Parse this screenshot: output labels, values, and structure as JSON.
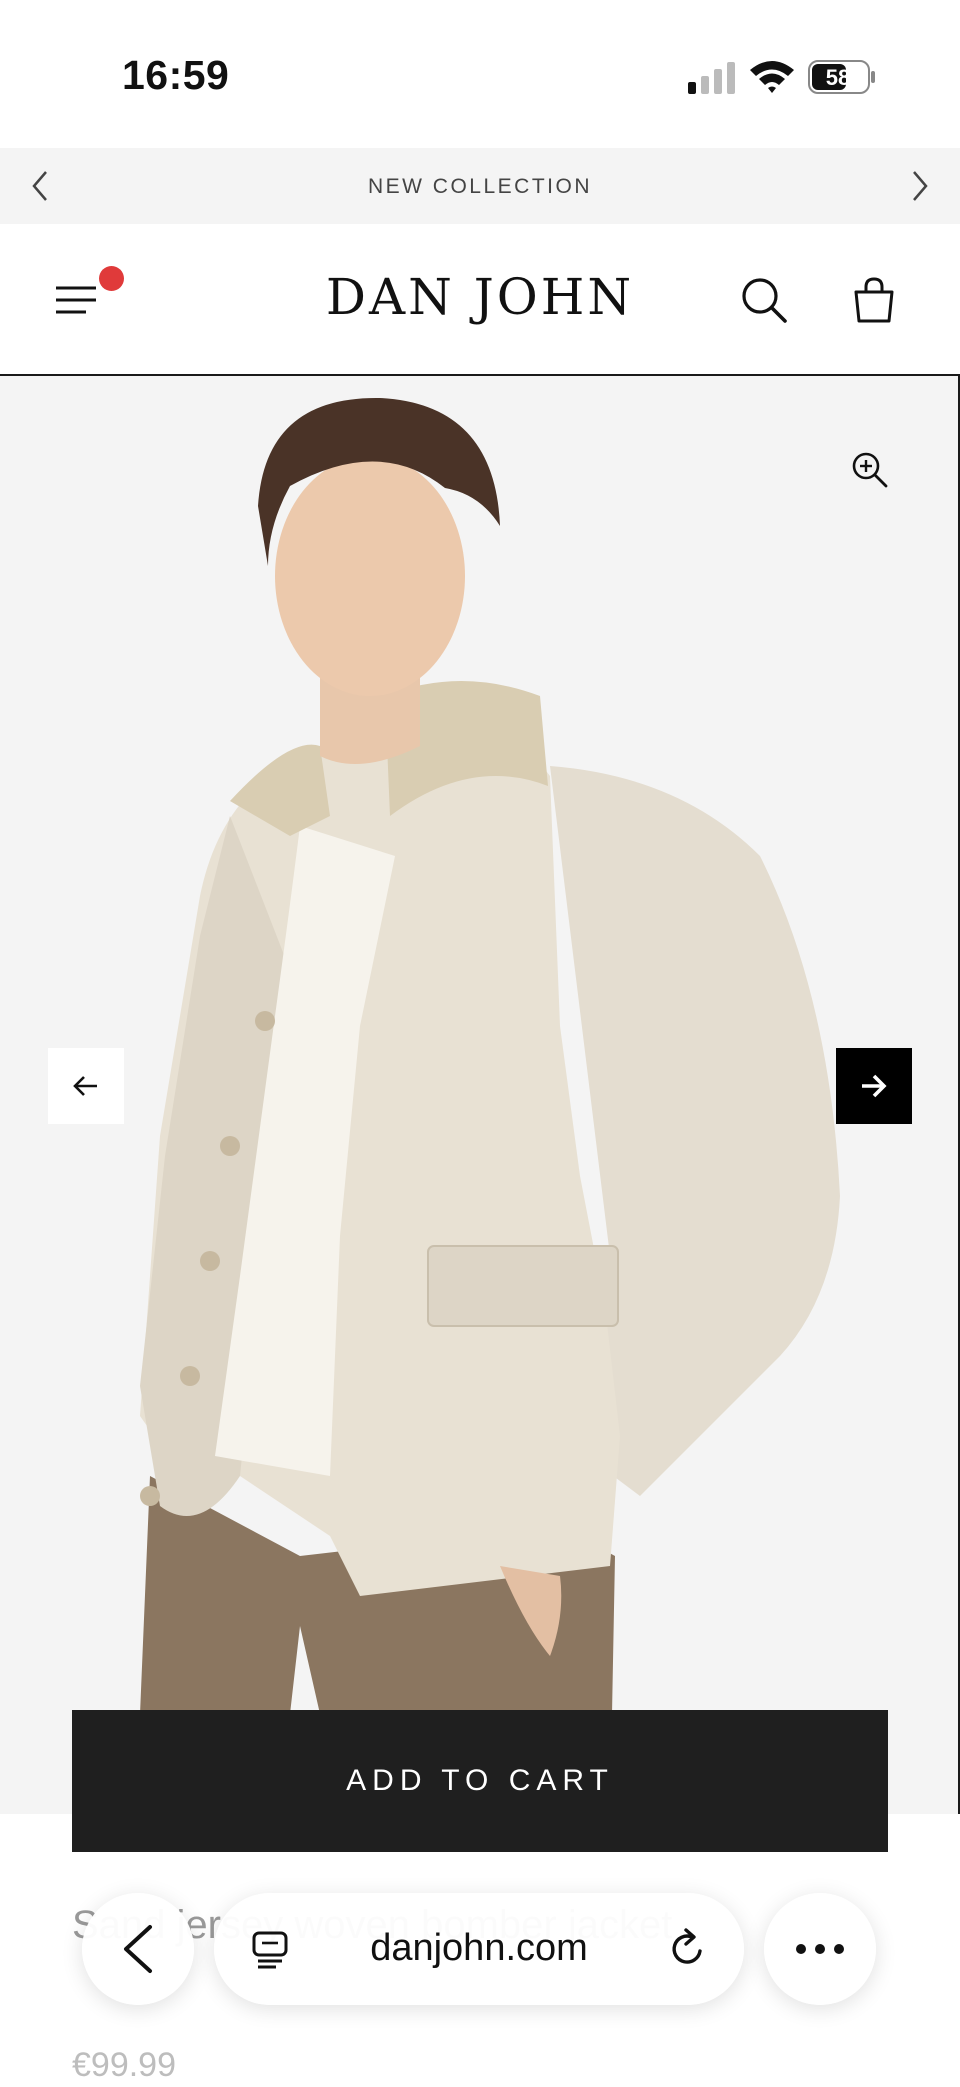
{
  "status_bar": {
    "time": "16:59",
    "battery": "58"
  },
  "announcement": {
    "text": "NEW COLLECTION",
    "prev_icon": "chevron-left-icon",
    "next_icon": "chevron-right-icon"
  },
  "header": {
    "logo": "DAN JOHN",
    "menu_icon": "hamburger-menu-icon",
    "notification_color": "#e03a3a",
    "search_icon": "search-icon",
    "bag_icon": "shopping-bag-icon"
  },
  "gallery": {
    "background": "#f4f4f4",
    "zoom_icon": "zoom-in-icon",
    "prev_icon": "arrow-left-icon",
    "next_icon": "arrow-right-icon",
    "image_description": "model-wearing-beige-jacket"
  },
  "cart": {
    "label": "ADD TO CART"
  },
  "product": {
    "title": "Sand jersey woven bomber jacket",
    "price": "€99.99"
  },
  "browser": {
    "url": "danjohn.com",
    "back_icon": "back-chevron-icon",
    "tabs_icon": "tabs-icon",
    "reload_icon": "reload-icon",
    "more_icon": "more-icon"
  }
}
